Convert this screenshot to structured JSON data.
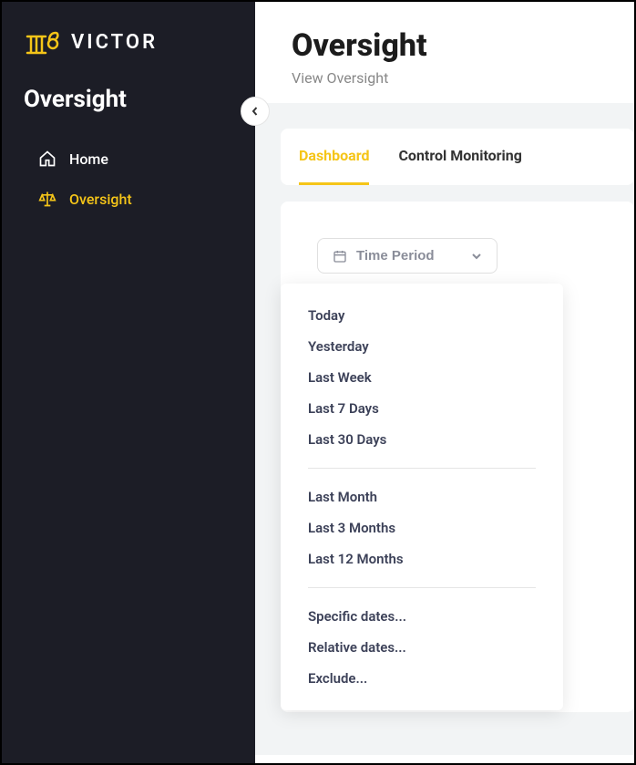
{
  "brand": {
    "name": "VICTOR"
  },
  "sidebar": {
    "section_title": "Oversight",
    "items": [
      {
        "label": "Home"
      },
      {
        "label": "Oversight"
      }
    ]
  },
  "page": {
    "title": "Oversight",
    "subtitle": "View Oversight"
  },
  "tabs": [
    {
      "label": "Dashboard"
    },
    {
      "label": "Control Monitoring"
    }
  ],
  "filter": {
    "time_period_label": "Time Period",
    "dropdown": {
      "group1": [
        "Today",
        "Yesterday",
        "Last Week",
        "Last 7 Days",
        "Last 30 Days"
      ],
      "group2": [
        "Last Month",
        "Last 3 Months",
        "Last 12 Months"
      ],
      "group3": [
        "Specific dates...",
        "Relative dates...",
        "Exclude..."
      ]
    }
  },
  "colors": {
    "accent": "#f5c518",
    "sidebar_bg": "#1c1d26",
    "content_bg": "#f2f4f5"
  }
}
